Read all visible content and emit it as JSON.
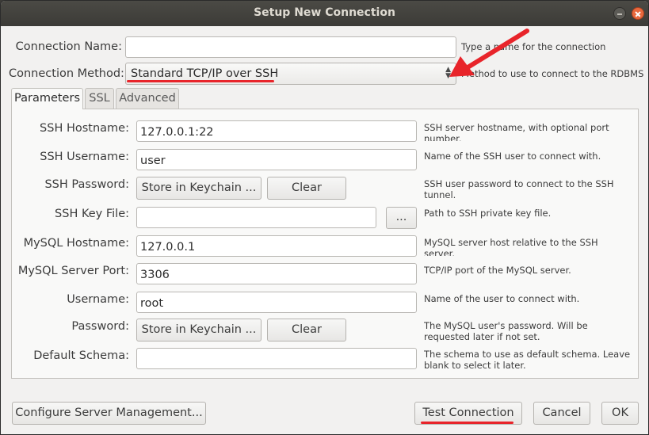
{
  "window": {
    "title": "Setup New Connection"
  },
  "connection": {
    "name_label": "Connection Name:",
    "name_value": "",
    "name_hint": "Type a name for the connection",
    "method_label": "Connection Method:",
    "method_value": "Standard TCP/IP over SSH",
    "method_hint": "Method to use to connect to the RDBMS"
  },
  "tabs": [
    {
      "label": "Parameters",
      "active": true
    },
    {
      "label": "SSL",
      "active": false
    },
    {
      "label": "Advanced",
      "active": false
    }
  ],
  "params": {
    "ssh_hostname": {
      "label": "SSH Hostname:",
      "value": "127.0.0.1:22",
      "hint": "SSH server hostname, with  optional port number."
    },
    "ssh_username": {
      "label": "SSH Username:",
      "value": "user",
      "hint": "Name of the SSH user to connect with."
    },
    "ssh_password": {
      "label": "SSH Password:",
      "store_label": "Store in Keychain ...",
      "clear_label": "Clear",
      "hint": "SSH user password to connect to the SSH tunnel."
    },
    "ssh_keyfile": {
      "label": "SSH Key File:",
      "value": "",
      "browse_label": "...",
      "hint": "Path to SSH private key file."
    },
    "mysql_hostname": {
      "label": "MySQL Hostname:",
      "value": "127.0.0.1",
      "hint": "MySQL server host relative to the SSH server."
    },
    "mysql_port": {
      "label": "MySQL Server Port:",
      "value": "3306",
      "hint": "TCP/IP port of the MySQL server."
    },
    "username": {
      "label": "Username:",
      "value": "root",
      "hint": "Name of the user to connect with."
    },
    "password": {
      "label": "Password:",
      "store_label": "Store in Keychain ...",
      "clear_label": "Clear",
      "hint": "The MySQL user's password. Will be requested later if not set."
    },
    "default_schema": {
      "label": "Default Schema:",
      "value": "",
      "hint": "The schema to use as default schema. Leave blank to select it later."
    }
  },
  "footer": {
    "configure_label": "Configure Server Management...",
    "test_label": "Test Connection",
    "cancel_label": "Cancel",
    "ok_label": "OK"
  },
  "colors": {
    "annotation": "#e8242a",
    "titlebar": "#3c3b37",
    "close": "#e9683d"
  }
}
